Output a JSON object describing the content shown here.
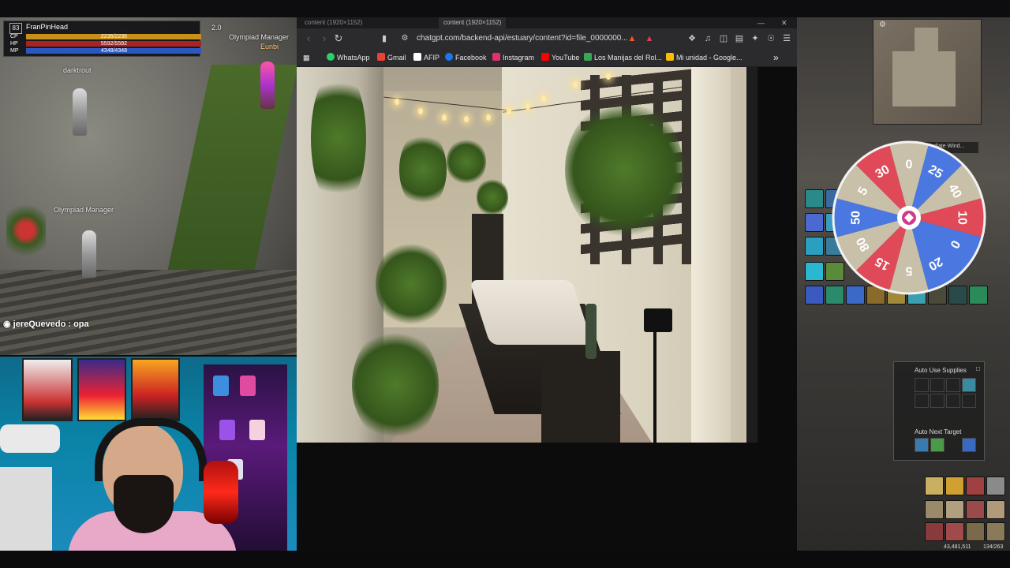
{
  "game": {
    "player": {
      "level": "83",
      "name": "FranPinHead",
      "bars": [
        {
          "label": "CP",
          "value": "2235/2235",
          "color": "#d8a020"
        },
        {
          "label": "HP",
          "value": "5592/5592",
          "color": "#b02828"
        },
        {
          "label": "MP",
          "value": "4348/4348",
          "color": "#2a58c0"
        }
      ]
    },
    "labels": {
      "olympiad_manager_top": "Olympiad Manager",
      "olympiad_manager": "Olympiad Manager",
      "darktrout": "darktrout",
      "eunbi": "Eunbi",
      "level_indicator": "2.0"
    },
    "chat": {
      "user": "jereQuevedo",
      "message": "opa",
      "text": "jereQuevedo : opa"
    }
  },
  "browser": {
    "tabs": [
      {
        "label": "content (1920×1152)",
        "active": false
      },
      {
        "label": "content (1920×1152)",
        "active": true
      }
    ],
    "url": "chatgpt.com/backend-api/estuary/content?id=file_0000000...",
    "bookmarks": [
      {
        "label": "WhatsApp",
        "color": "#25d366"
      },
      {
        "label": "Gmail",
        "color": "#ea4335"
      },
      {
        "label": "AFIP",
        "color": "#ffffff"
      },
      {
        "label": "Facebook",
        "color": "#1877f2"
      },
      {
        "label": "Instagram",
        "color": "#e1306c"
      },
      {
        "label": "YouTube",
        "color": "#ff0000"
      },
      {
        "label": "Los Manijas del Rol...",
        "color": "#3aa757"
      },
      {
        "label": "Mi unidad - Google...",
        "color": "#fbbc04"
      }
    ],
    "more_bookmarks": "»"
  },
  "right_game": {
    "auto_use_title": "Auto Use Supplies",
    "auto_target_title": "Auto Next Target",
    "coords": "43,481,511",
    "count": "134/263",
    "wheel_label": "Immediate Wind..."
  },
  "wheel": {
    "segments": [
      {
        "label": "25",
        "color": "#4a78e0"
      },
      {
        "label": "40",
        "color": "#c8c0a8"
      },
      {
        "label": "10",
        "color": "#e04a58"
      },
      {
        "label": "0",
        "color": "#4a78e0"
      },
      {
        "label": "20",
        "color": "#4a78e0"
      },
      {
        "label": "5",
        "color": "#c8c0a8"
      },
      {
        "label": "15",
        "color": "#e04a58"
      },
      {
        "label": "80",
        "color": "#c8c0a8"
      },
      {
        "label": "50",
        "color": "#4a78e0"
      },
      {
        "label": "5",
        "color": "#c8c0a8"
      },
      {
        "label": "30",
        "color": "#e04a58"
      },
      {
        "label": "0",
        "color": "#c8c0a8"
      }
    ]
  }
}
